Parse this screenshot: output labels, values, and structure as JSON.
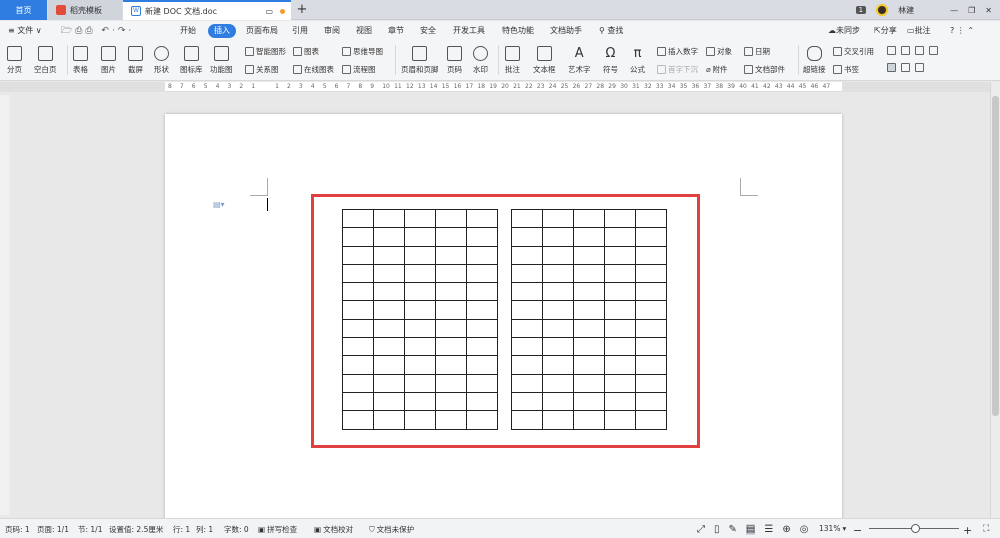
{
  "tabs": {
    "home": "首页",
    "templates": "稻壳模板",
    "document": "新建 DOC 文档.doc",
    "new_tab": "+"
  },
  "window": {
    "badge": "1",
    "user_name": "林建"
  },
  "menu": {
    "file": "文件",
    "items": [
      "开始",
      "插入",
      "页面布局",
      "引用",
      "审阅",
      "视图",
      "章节",
      "安全",
      "开发工具",
      "特色功能",
      "文档助手"
    ],
    "active": "插入",
    "search": "查找",
    "sync": "未同步",
    "share": "分享",
    "comment": "批注",
    "help": "?"
  },
  "toolbar": {
    "page_break": "分页",
    "blank_page": "空白页",
    "table": "表格",
    "picture": "图片",
    "screenshot": "截屏",
    "shape": "形状",
    "icon_library": "图标库",
    "function_chart": "功能图",
    "smart_art": "智能图形",
    "chart": "图表",
    "mind_map": "思维导图",
    "relation_chart": "关系图",
    "online_chart": "在线图表",
    "flowchart": "流程图",
    "header_footer": "页眉和页脚",
    "page_number": "页码",
    "watermark": "水印",
    "comment": "批注",
    "textbox": "文本框",
    "word_art": "艺术字",
    "symbol": "符号",
    "formula": "公式",
    "insert_number": "插入数字",
    "object": "对象",
    "date": "日期",
    "drop_cap": "首字下沉",
    "attachment": "附件",
    "doc_parts": "文档部件",
    "hyperlink": "超链接",
    "cross_ref": "交叉引用",
    "bookmark": "书签"
  },
  "ruler": {
    "numbers": [
      "8",
      "7",
      "6",
      "5",
      "4",
      "3",
      "2",
      "1",
      "",
      "1",
      "2",
      "3",
      "4",
      "5",
      "6",
      "7",
      "8",
      "9",
      "10",
      "11",
      "12",
      "13",
      "14",
      "15",
      "16",
      "17",
      "18",
      "19",
      "20",
      "21",
      "22",
      "23",
      "24",
      "25",
      "26",
      "27",
      "28",
      "29",
      "30",
      "31",
      "32",
      "33",
      "34",
      "35",
      "36",
      "37",
      "38",
      "39",
      "40",
      "41",
      "42",
      "43",
      "44",
      "45",
      "46",
      "47"
    ]
  },
  "document": {
    "tables": [
      {
        "rows": 12,
        "cols": 5
      },
      {
        "rows": 12,
        "cols": 5
      }
    ]
  },
  "status": {
    "page_num": "页码: 1",
    "page_count": "页面: 1/1",
    "section": "节: 1/1",
    "setting": "设置值: 2.5厘米",
    "row": "行: 1",
    "col": "列: 1",
    "word_count": "字数: 0",
    "spell_check": "拼写检查",
    "proofread": "文档校对",
    "protection": "文档未保护",
    "zoom": "131%"
  },
  "colors": {
    "accent": "#2f7de1",
    "highlight": "#e24040"
  }
}
